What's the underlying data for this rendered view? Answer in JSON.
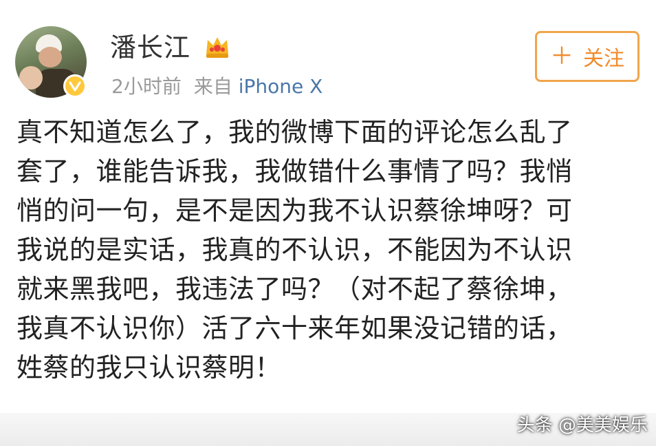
{
  "user": {
    "name": "潘长江",
    "time": "2小时前",
    "source_prefix": "来自",
    "source": "iPhone X"
  },
  "follow": {
    "plus": "＋",
    "label": "关注"
  },
  "post": {
    "lines": [
      "真不知道怎么了，我的微博下面的评论怎么乱了",
      "套了，谁能告诉我，我做错什么事情了吗？我悄",
      "悄的问一句，是不是因为我不认识蔡徐坤呀？可",
      "我说的是实话，我真的不认识，不能因为不认识",
      "就来黑我吧，我违法了吗？（对不起了蔡徐坤，",
      "我真不认识你）活了六十来年如果没记错的话，",
      "姓蔡的我只认识蔡明！"
    ]
  },
  "watermark": "头条 @美美娱乐",
  "icons": {
    "avatar": "user-avatar",
    "verified": "verified-v-icon",
    "crown": "crown-icon",
    "plus": "plus-icon"
  },
  "colors": {
    "accent": "#f08a2a",
    "link": "#4a76a8",
    "badge": "#ffc93b"
  }
}
